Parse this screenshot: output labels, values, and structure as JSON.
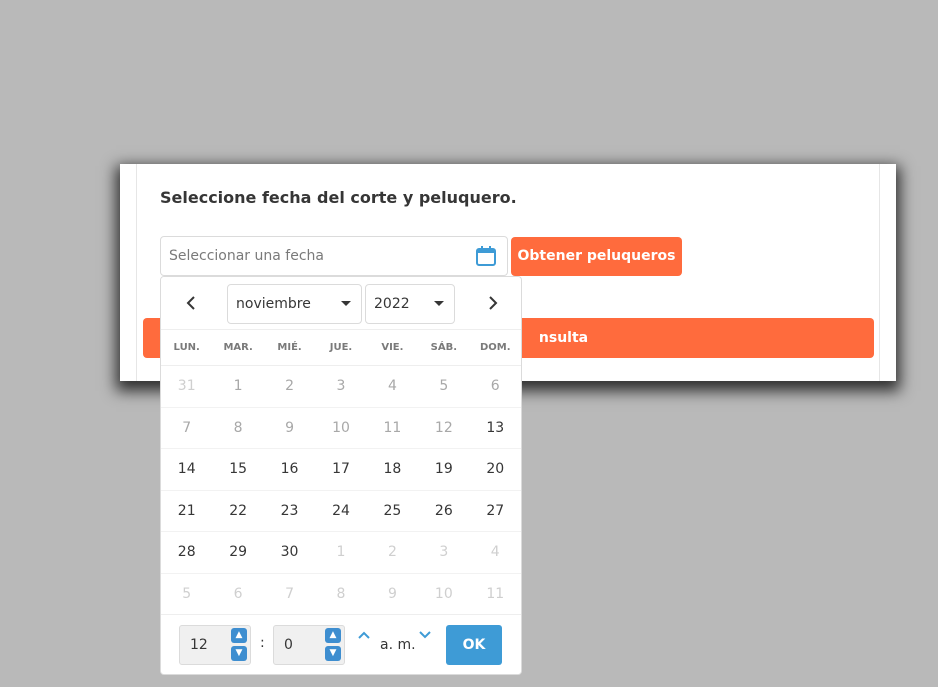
{
  "form": {
    "title": "Seleccione fecha del corte y peluquero.",
    "date_placeholder": "Seleccionar una fecha",
    "get_barbers_label": "Obtener peluqueros",
    "submit_label_visible": "nsulta"
  },
  "datepicker": {
    "month": "noviembre",
    "year": "2022",
    "weekdays": [
      "LUN.",
      "MAR.",
      "MIÉ.",
      "JUE.",
      "VIE.",
      "SÁB.",
      "DOM."
    ],
    "weeks": [
      [
        {
          "d": "31",
          "s": "off"
        },
        {
          "d": "1",
          "s": "dis"
        },
        {
          "d": "2",
          "s": "dis"
        },
        {
          "d": "3",
          "s": "dis"
        },
        {
          "d": "4",
          "s": "dis"
        },
        {
          "d": "5",
          "s": "dis"
        },
        {
          "d": "6",
          "s": "dis"
        }
      ],
      [
        {
          "d": "7",
          "s": "dis"
        },
        {
          "d": "8",
          "s": "dis"
        },
        {
          "d": "9",
          "s": "dis"
        },
        {
          "d": "10",
          "s": "dis"
        },
        {
          "d": "11",
          "s": "dis"
        },
        {
          "d": "12",
          "s": "dis"
        },
        {
          "d": "13",
          "s": "on"
        }
      ],
      [
        {
          "d": "14",
          "s": "on"
        },
        {
          "d": "15",
          "s": "on"
        },
        {
          "d": "16",
          "s": "on"
        },
        {
          "d": "17",
          "s": "on"
        },
        {
          "d": "18",
          "s": "on"
        },
        {
          "d": "19",
          "s": "on"
        },
        {
          "d": "20",
          "s": "on"
        }
      ],
      [
        {
          "d": "21",
          "s": "on"
        },
        {
          "d": "22",
          "s": "on"
        },
        {
          "d": "23",
          "s": "on"
        },
        {
          "d": "24",
          "s": "on"
        },
        {
          "d": "25",
          "s": "on"
        },
        {
          "d": "26",
          "s": "on"
        },
        {
          "d": "27",
          "s": "on"
        }
      ],
      [
        {
          "d": "28",
          "s": "on"
        },
        {
          "d": "29",
          "s": "on"
        },
        {
          "d": "30",
          "s": "on"
        },
        {
          "d": "1",
          "s": "off"
        },
        {
          "d": "2",
          "s": "off"
        },
        {
          "d": "3",
          "s": "off"
        },
        {
          "d": "4",
          "s": "off"
        }
      ],
      [
        {
          "d": "5",
          "s": "off"
        },
        {
          "d": "6",
          "s": "off"
        },
        {
          "d": "7",
          "s": "off"
        },
        {
          "d": "8",
          "s": "off"
        },
        {
          "d": "9",
          "s": "off"
        },
        {
          "d": "10",
          "s": "off"
        },
        {
          "d": "11",
          "s": "off"
        }
      ]
    ],
    "time": {
      "hours": "12",
      "minutes": "0",
      "separator": ":",
      "meridiem": "a. m.",
      "ok_label": "OK"
    },
    "icons": {
      "prev": "chevron-left-icon",
      "next": "chevron-right-icon",
      "calendar": "calendar-icon"
    }
  },
  "colors": {
    "accent_orange": "#ff6b3d",
    "accent_blue": "#3e9bd6",
    "backdrop": "#b9b9b9"
  }
}
